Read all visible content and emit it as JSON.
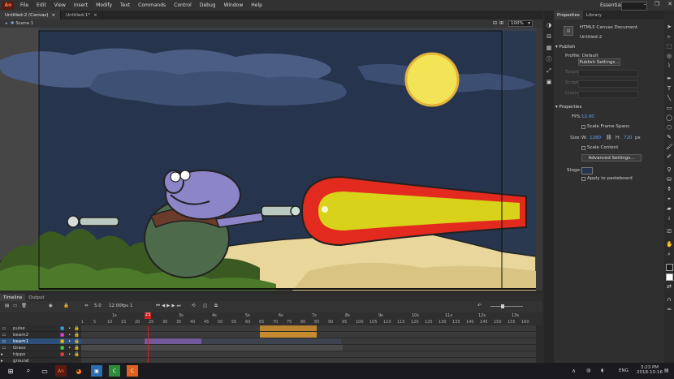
{
  "app": {
    "logo_text": "An",
    "menu": [
      "File",
      "Edit",
      "View",
      "Insert",
      "Modify",
      "Text",
      "Commands",
      "Control",
      "Debug",
      "Window",
      "Help"
    ],
    "workspace": "Essentials",
    "window_controls": [
      "–",
      "❐",
      "✕"
    ]
  },
  "doc_tabs": [
    {
      "label": "Untitled-2 (Canvas)",
      "active": true
    },
    {
      "label": "Untitled-1*",
      "active": false
    }
  ],
  "editbar": {
    "scene": "Scene 1",
    "zoom": "100%"
  },
  "timeline": {
    "tabs": [
      "Timeline",
      "Output"
    ],
    "fps": "12.00",
    "fps_unit": "fps",
    "frame": "1",
    "frame_display": "5.0",
    "seconds": [
      "1s",
      "2s",
      "3s",
      "4s",
      "5s",
      "6s",
      "7s",
      "8s",
      "9s",
      "10s",
      "11s",
      "12s",
      "13s"
    ],
    "frame_numbers": [
      "1",
      "5",
      "10",
      "15",
      "20",
      "25",
      "30",
      "35",
      "40",
      "45",
      "50",
      "55",
      "60",
      "65",
      "70",
      "75",
      "80",
      "85",
      "90",
      "95",
      "100",
      "105",
      "110",
      "115",
      "120",
      "125",
      "130",
      "135",
      "140",
      "145",
      "150",
      "155",
      "160"
    ],
    "playhead_frame": "23",
    "layers": [
      {
        "name": "pulse",
        "selected": false
      },
      {
        "name": "beam2",
        "selected": false
      },
      {
        "name": "beam1",
        "selected": true
      },
      {
        "name": "Grass",
        "selected": false
      },
      {
        "name": "hippo",
        "selected": false
      },
      {
        "name": "ground",
        "selected": false
      }
    ]
  },
  "properties": {
    "tabs": [
      "Properties",
      "Library"
    ],
    "doc_type": "HTML5 Canvas Document",
    "doc_name": "Untitled-2",
    "publish_section": "Publish",
    "profile_label": "Profile:",
    "profile_value": "Default",
    "publish_settings_btn": "Publish Settings...",
    "target_label": "Target:",
    "script_label": "Script:",
    "class_label": "Class:",
    "properties_section": "Properties",
    "fps_label": "FPS:",
    "fps_value": "12.00",
    "scale_frame_spans": "Scale Frame Spans",
    "size_label": "Size:",
    "w_label": "W:",
    "w_value": "1280",
    "h_label": "H:",
    "h_value": "720",
    "px_label": "px",
    "scale_content": "Scale Content",
    "advanced_settings_btn": "Advanced Settings...",
    "stage_label": "Stage:",
    "stage_color": "#26344d",
    "apply_pasteboard": "Apply to pasteboard"
  },
  "taskbar": {
    "lang": "ENG",
    "time": "3:23 PM",
    "date": "2018-10-16"
  },
  "colors": {
    "accent": "#2d4f7a",
    "stage_sky": "#26344d",
    "beam_red": "#e22a1e",
    "beam_yellow": "#d8d21a",
    "moon": "#f3e356",
    "sand": "#e8d69a",
    "grass": "#3b5a22",
    "hippo": "#8c86c9"
  }
}
